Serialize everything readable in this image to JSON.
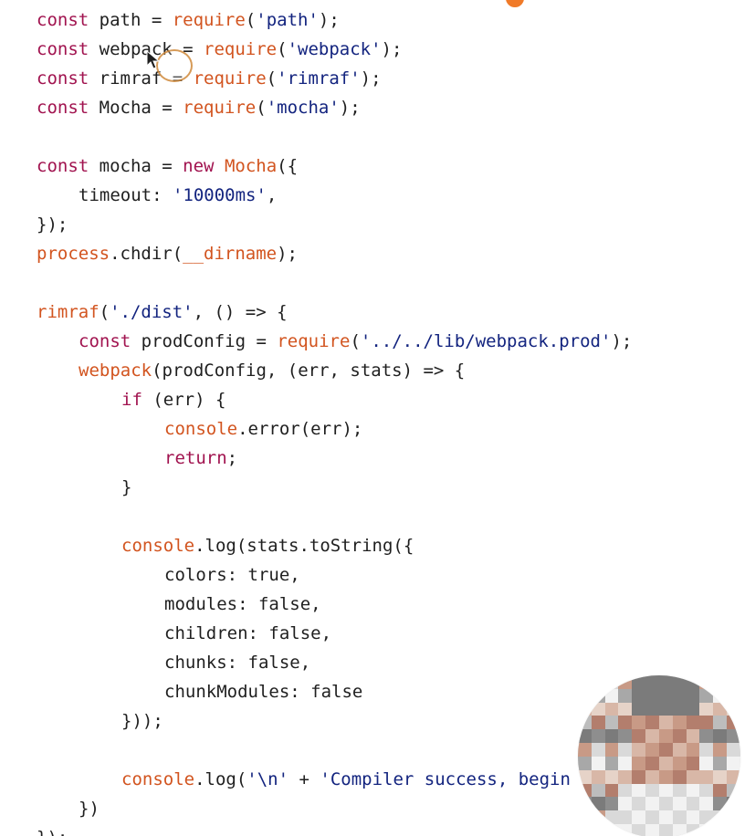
{
  "editor": {
    "lines": [
      {
        "tokens": [
          {
            "text": "const",
            "color": "#a1134f"
          },
          {
            "text": " path = ",
            "color": "#1f1f1f"
          },
          {
            "text": "require",
            "color": "#d2541f"
          },
          {
            "text": "(",
            "color": "#1f1f1f"
          },
          {
            "text": "'path'",
            "color": "#13247f"
          },
          {
            "text": ");",
            "color": "#1f1f1f"
          }
        ]
      },
      {
        "tokens": [
          {
            "text": "const",
            "color": "#a1134f"
          },
          {
            "text": " webpack = ",
            "color": "#1f1f1f"
          },
          {
            "text": "require",
            "color": "#d2541f"
          },
          {
            "text": "(",
            "color": "#1f1f1f"
          },
          {
            "text": "'webpack'",
            "color": "#13247f"
          },
          {
            "text": ");",
            "color": "#1f1f1f"
          }
        ]
      },
      {
        "tokens": [
          {
            "text": "const",
            "color": "#a1134f"
          },
          {
            "text": " rimraf = ",
            "color": "#1f1f1f"
          },
          {
            "text": "require",
            "color": "#d2541f"
          },
          {
            "text": "(",
            "color": "#1f1f1f"
          },
          {
            "text": "'rimraf'",
            "color": "#13247f"
          },
          {
            "text": ");",
            "color": "#1f1f1f"
          }
        ]
      },
      {
        "tokens": [
          {
            "text": "const",
            "color": "#a1134f"
          },
          {
            "text": " Mocha = ",
            "color": "#1f1f1f"
          },
          {
            "text": "require",
            "color": "#d2541f"
          },
          {
            "text": "(",
            "color": "#1f1f1f"
          },
          {
            "text": "'mocha'",
            "color": "#13247f"
          },
          {
            "text": ");",
            "color": "#1f1f1f"
          }
        ]
      },
      {
        "tokens": []
      },
      {
        "tokens": [
          {
            "text": "const",
            "color": "#a1134f"
          },
          {
            "text": " mocha = ",
            "color": "#1f1f1f"
          },
          {
            "text": "new",
            "color": "#a1134f"
          },
          {
            "text": " ",
            "color": "#1f1f1f"
          },
          {
            "text": "Mocha",
            "color": "#d2541f"
          },
          {
            "text": "({",
            "color": "#1f1f1f"
          }
        ]
      },
      {
        "tokens": [
          {
            "text": "timeout: ",
            "color": "#1f1f1f"
          },
          {
            "text": "'10000ms'",
            "color": "#13247f"
          },
          {
            "text": ",",
            "color": "#1f1f1f"
          }
        ]
      },
      {
        "tokens": [
          {
            "text": "});",
            "color": "#1f1f1f"
          }
        ]
      },
      {
        "tokens": [
          {
            "text": "process",
            "color": "#d2541f"
          },
          {
            "text": ".chdir(",
            "color": "#1f1f1f"
          },
          {
            "text": "__dirname",
            "color": "#d2541f"
          },
          {
            "text": ");",
            "color": "#1f1f1f"
          }
        ]
      },
      {
        "tokens": []
      },
      {
        "tokens": [
          {
            "text": "rimraf",
            "color": "#d2541f"
          },
          {
            "text": "(",
            "color": "#1f1f1f"
          },
          {
            "text": "'./dist'",
            "color": "#13247f"
          },
          {
            "text": ", () => {",
            "color": "#1f1f1f"
          }
        ]
      },
      {
        "tokens": [
          {
            "text": "const",
            "color": "#a1134f"
          },
          {
            "text": " prodConfig = ",
            "color": "#1f1f1f"
          },
          {
            "text": "require",
            "color": "#d2541f"
          },
          {
            "text": "(",
            "color": "#1f1f1f"
          },
          {
            "text": "'../../lib/webpack.prod'",
            "color": "#13247f"
          },
          {
            "text": ");",
            "color": "#1f1f1f"
          }
        ]
      },
      {
        "tokens": [
          {
            "text": "webpack",
            "color": "#d2541f"
          },
          {
            "text": "(prodConfig, (err, stats) => {",
            "color": "#1f1f1f"
          }
        ]
      },
      {
        "tokens": [
          {
            "text": "if",
            "color": "#a1134f"
          },
          {
            "text": " (err) {",
            "color": "#1f1f1f"
          }
        ]
      },
      {
        "tokens": [
          {
            "text": "console",
            "color": "#d2541f"
          },
          {
            "text": ".error(err);",
            "color": "#1f1f1f"
          }
        ]
      },
      {
        "tokens": [
          {
            "text": "return",
            "color": "#a1134f"
          },
          {
            "text": ";",
            "color": "#1f1f1f"
          }
        ]
      },
      {
        "tokens": [
          {
            "text": "}",
            "color": "#1f1f1f"
          }
        ]
      },
      {
        "tokens": []
      },
      {
        "tokens": [
          {
            "text": "console",
            "color": "#d2541f"
          },
          {
            "text": ".log(stats.toString({",
            "color": "#1f1f1f"
          }
        ]
      },
      {
        "tokens": [
          {
            "text": "colors: true,",
            "color": "#1f1f1f"
          }
        ]
      },
      {
        "tokens": [
          {
            "text": "modules: false,",
            "color": "#1f1f1f"
          }
        ]
      },
      {
        "tokens": [
          {
            "text": "children: false,",
            "color": "#1f1f1f"
          }
        ]
      },
      {
        "tokens": [
          {
            "text": "chunks: false,",
            "color": "#1f1f1f"
          }
        ]
      },
      {
        "tokens": [
          {
            "text": "chunkModules: false",
            "color": "#1f1f1f"
          }
        ]
      },
      {
        "tokens": [
          {
            "text": "}));",
            "color": "#1f1f1f"
          }
        ]
      },
      {
        "tokens": []
      },
      {
        "tokens": [
          {
            "text": "console",
            "color": "#d2541f"
          },
          {
            "text": ".log(",
            "color": "#1f1f1f"
          },
          {
            "text": "'\\n'",
            "color": "#13247f"
          },
          {
            "text": " + ",
            "color": "#1f1f1f"
          },
          {
            "text": "'Compiler success, begin",
            "color": "#13247f"
          }
        ]
      },
      {
        "tokens": [
          {
            "text": "})",
            "color": "#1f1f1f"
          }
        ]
      },
      {
        "tokens": [
          {
            "text": "});",
            "color": "#1f1f1f"
          }
        ]
      }
    ]
  },
  "webcam": {
    "icon": "webcam-blurred-person-icon"
  },
  "pointer": {
    "icon": "mouse-pointer-icon"
  }
}
